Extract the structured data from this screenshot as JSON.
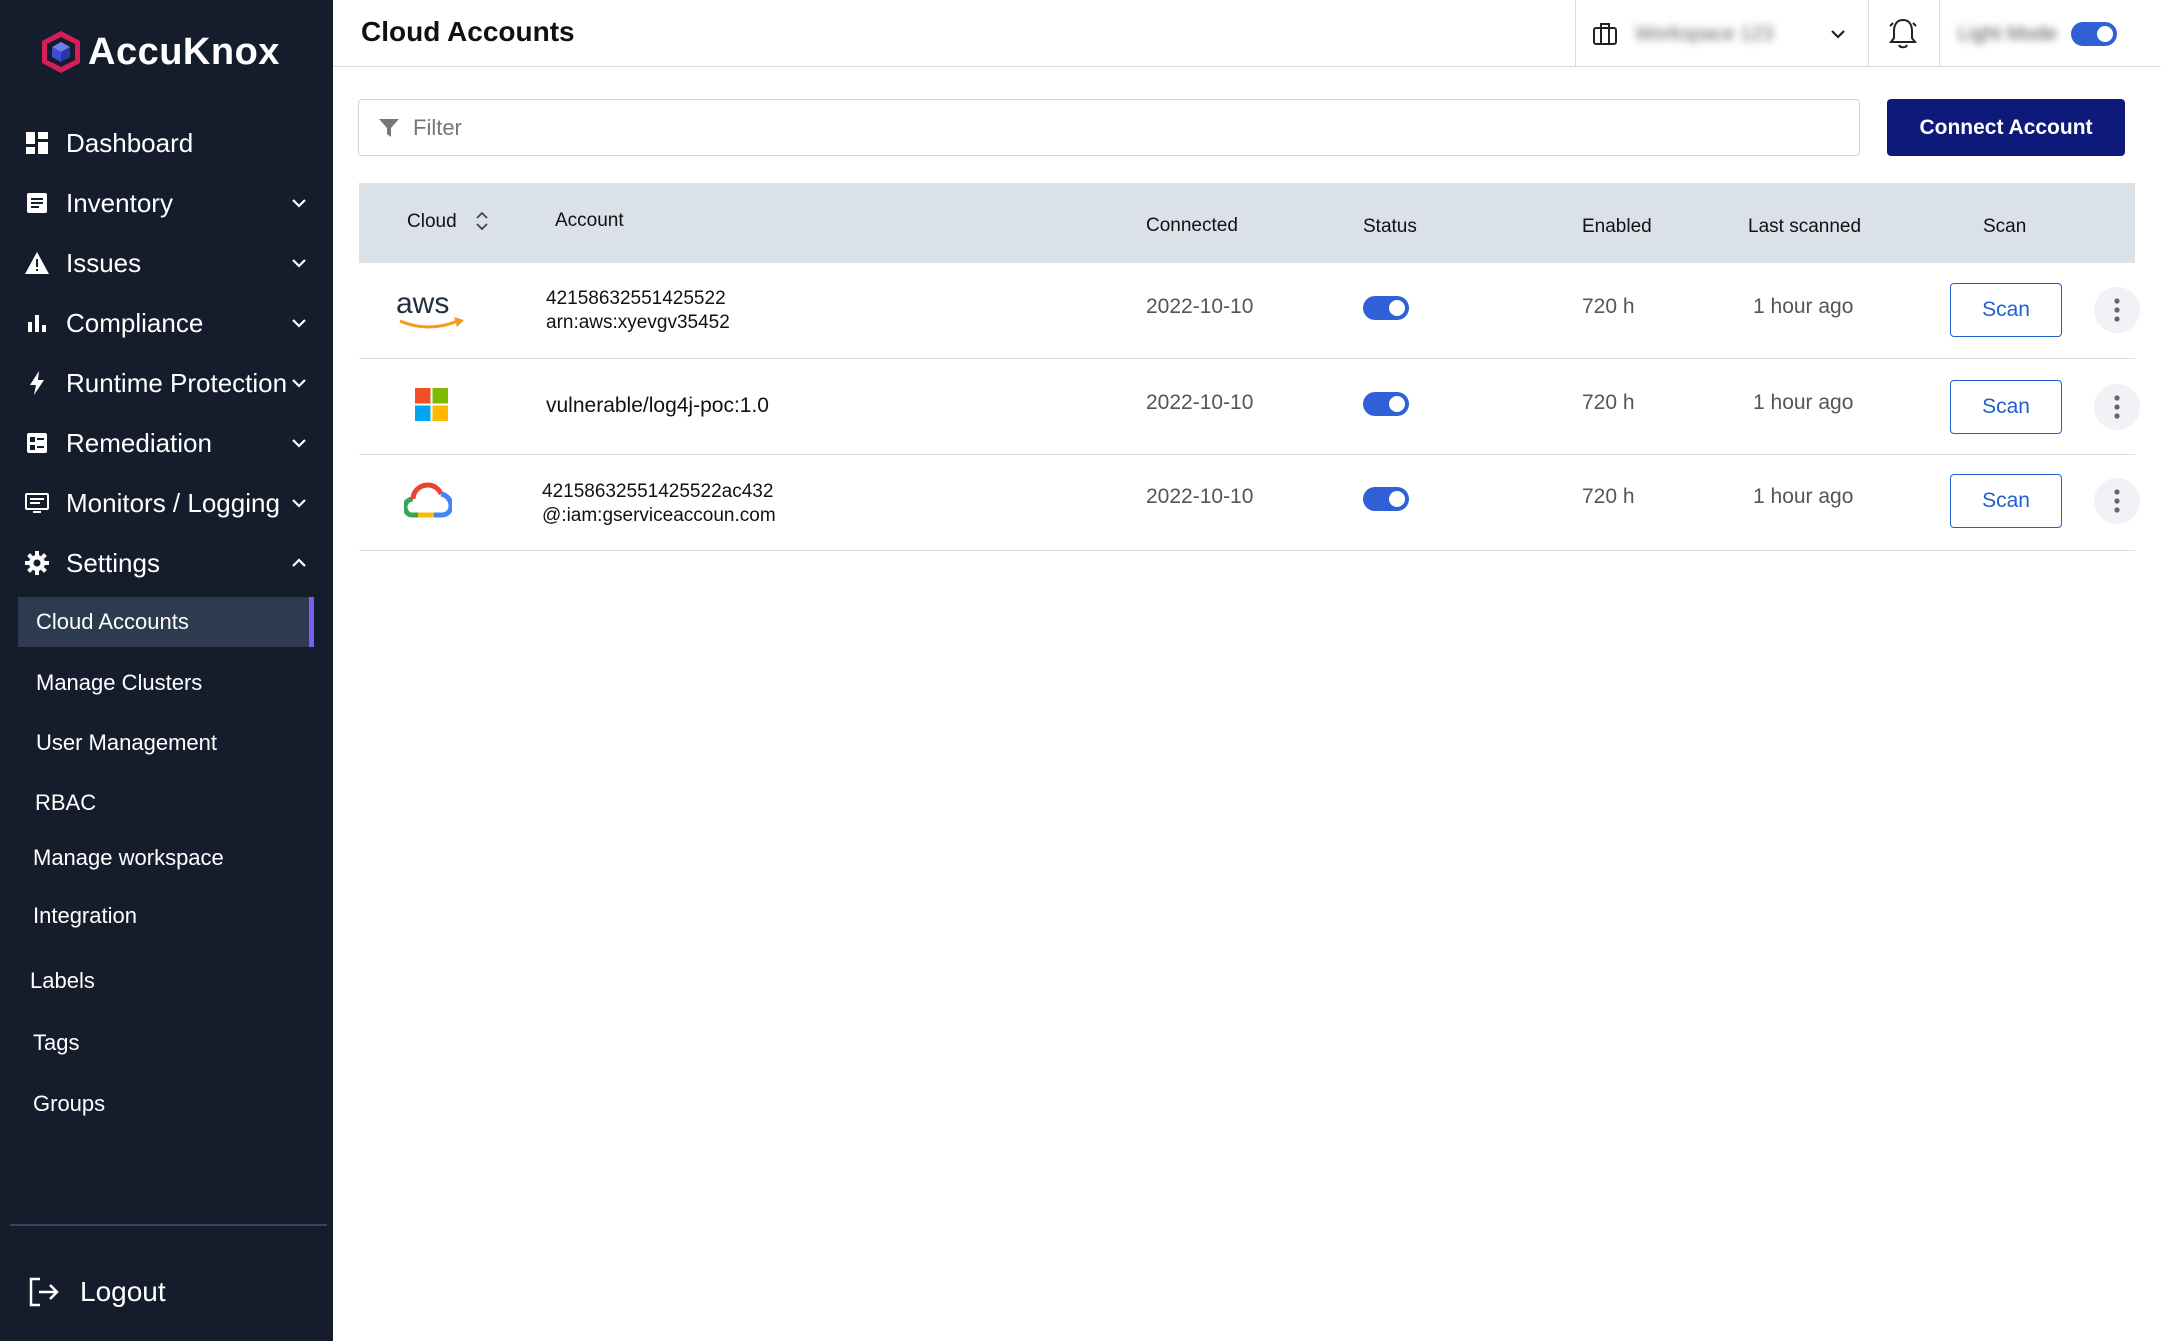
{
  "brand": {
    "name": "AccuKnox"
  },
  "sidebar": {
    "items": [
      {
        "label": "Dashboard",
        "icon": "dashboard-icon"
      },
      {
        "label": "Inventory",
        "icon": "inventory-icon"
      },
      {
        "label": "Issues",
        "icon": "warning-icon"
      },
      {
        "label": "Compliance",
        "icon": "bar-chart-icon"
      },
      {
        "label": "Runtime Protection",
        "icon": "bolt-icon"
      },
      {
        "label": "Remediation",
        "icon": "remediation-icon"
      },
      {
        "label": "Monitors / Logging",
        "icon": "monitor-icon"
      },
      {
        "label": "Settings",
        "icon": "gear-icon"
      }
    ],
    "sub_items": [
      {
        "label": "Cloud Accounts"
      },
      {
        "label": "Manage Clusters"
      },
      {
        "label": "User Management"
      },
      {
        "label": "RBAC"
      },
      {
        "label": "Manage workspace"
      },
      {
        "label": "Integration"
      },
      {
        "label": "Labels"
      },
      {
        "label": "Tags"
      },
      {
        "label": "Groups"
      }
    ],
    "logout_label": "Logout"
  },
  "header": {
    "title": "Cloud Accounts",
    "workspace_name": "Workspace 123",
    "mode_label": "Light Mode"
  },
  "filter": {
    "placeholder": "Filter"
  },
  "connect_button": "Connect Account",
  "table": {
    "columns": {
      "cloud": "Cloud",
      "account": "Account",
      "connected": "Connected",
      "status": "Status",
      "enabled": "Enabled",
      "last_scanned": "Last scanned",
      "scan": "Scan"
    },
    "rows": [
      {
        "cloud": "aws",
        "account_line1": "42158632551425522",
        "account_line2": "arn:aws:xyevgv35452",
        "connected": "2022-10-10",
        "status_on": true,
        "enabled": "720 h",
        "last_scanned": "1 hour ago",
        "scan_label": "Scan"
      },
      {
        "cloud": "azure",
        "account_line1": "vulnerable/log4j-poc:1.0",
        "account_line2": "",
        "connected": "2022-10-10",
        "status_on": true,
        "enabled": "720 h",
        "last_scanned": "1 hour ago",
        "scan_label": "Scan"
      },
      {
        "cloud": "gcp",
        "account_line1": "42158632551425522ac432",
        "account_line2": "@:iam:gserviceaccoun.com",
        "connected": "2022-10-10",
        "status_on": true,
        "enabled": "720 h",
        "last_scanned": "1 hour ago",
        "scan_label": "Scan"
      }
    ]
  },
  "colors": {
    "sidebar_bg": "#151d2c",
    "primary": "#0e1a7a",
    "accent": "#1f5fd0",
    "active_marker": "#7b5cf0",
    "table_header_bg": "#dbe1e8"
  }
}
